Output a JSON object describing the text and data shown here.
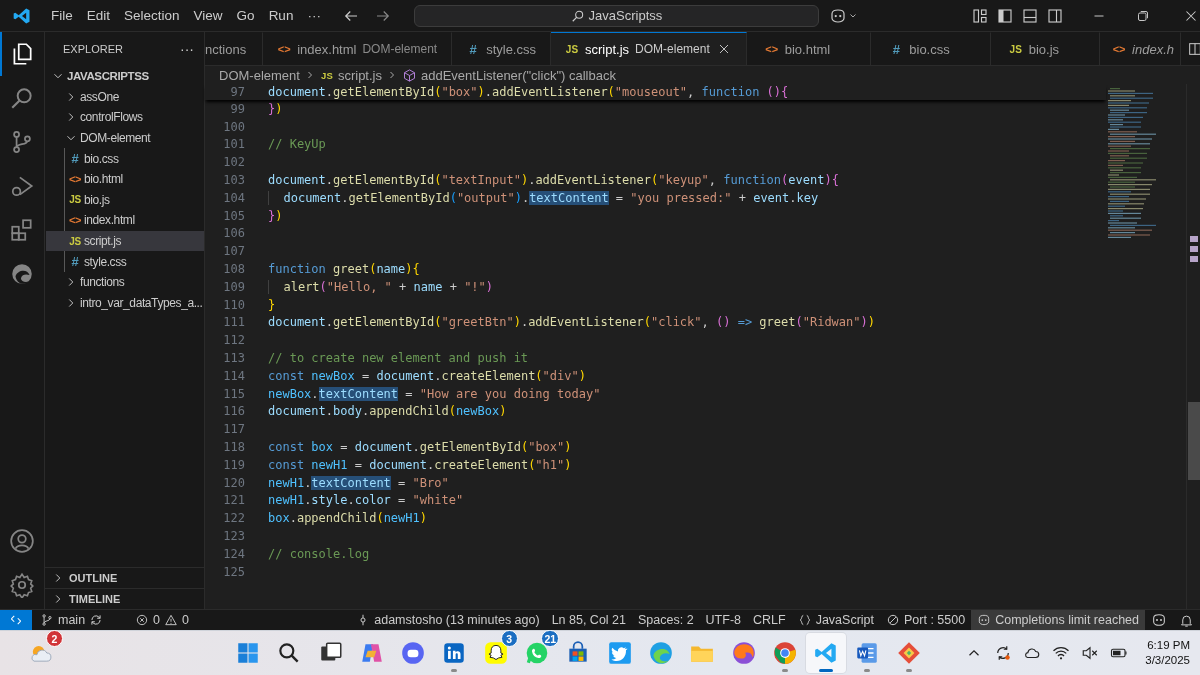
{
  "title_bar": {
    "menus": [
      "File",
      "Edit",
      "Selection",
      "View",
      "Go",
      "Run"
    ],
    "more": "···",
    "search": "JavaScriptss"
  },
  "activity_bar": [
    {
      "kind": "files",
      "selected": true
    },
    {
      "kind": "search",
      "selected": false
    },
    {
      "kind": "branch",
      "selected": false
    },
    {
      "kind": "debug",
      "selected": false
    },
    {
      "kind": "extensions",
      "selected": false
    },
    {
      "kind": "browser",
      "selected": false
    }
  ],
  "sidebar": {
    "title": "EXPLORER",
    "more": "···",
    "root": {
      "label": "JAVASCRIPTSS",
      "expanded": true,
      "children": [
        {
          "label": "assOne",
          "expanded": false,
          "selected": false
        },
        {
          "label": "controlFlows",
          "expanded": false,
          "selected": false
        },
        {
          "label": "DOM-element",
          "expanded": true,
          "selected": false,
          "children": [
            {
              "label": "bio.css",
              "kind": "css",
              "icon": "#",
              "selected": false
            },
            {
              "label": "bio.html",
              "kind": "html",
              "icon": "<>",
              "selected": false
            },
            {
              "label": "bio.js",
              "kind": "js",
              "icon": "JS",
              "selected": false
            },
            {
              "label": "index.html",
              "kind": "html",
              "icon": "<>",
              "selected": false
            },
            {
              "label": "script.js",
              "kind": "js",
              "icon": "JS",
              "selected": true
            },
            {
              "label": "style.css",
              "kind": "css",
              "icon": "#",
              "selected": false
            }
          ]
        },
        {
          "label": "functions",
          "expanded": false,
          "selected": false
        },
        {
          "label": "intro_var_dataTypes_a...",
          "expanded": false,
          "selected": false
        }
      ]
    },
    "sections": [
      {
        "label": "OUTLINE",
        "expanded": false
      },
      {
        "label": "TIMELINE",
        "expanded": false
      }
    ]
  },
  "tabs": [
    {
      "label": "nctions",
      "selected": false,
      "preview": false
    },
    {
      "label": "index.html",
      "detail": "DOM-element",
      "kind": "html",
      "icon": "<>",
      "selected": false,
      "preview": false
    },
    {
      "label": "style.css",
      "kind": "css",
      "icon": "#",
      "selected": false,
      "preview": false
    },
    {
      "label": "script.js",
      "detail": "DOM-element",
      "kind": "js",
      "icon": "JS",
      "selected": true,
      "preview": false
    },
    {
      "label": "bio.html",
      "kind": "html",
      "icon": "<>",
      "selected": false,
      "preview": false
    },
    {
      "label": "bio.css",
      "kind": "css",
      "icon": "#",
      "selected": false,
      "preview": false
    },
    {
      "label": "bio.js",
      "kind": "js",
      "icon": "JS",
      "selected": false,
      "preview": false
    },
    {
      "label": "index.h",
      "kind": "html",
      "icon": "<>",
      "selected": false,
      "preview": true
    }
  ],
  "breadcrumb": [
    {
      "kind": "folder",
      "text": "DOM-element"
    },
    {
      "kind": "js",
      "icon": "JS",
      "text": "script.js"
    },
    {
      "kind": "method",
      "text": "addEventListener(\"click\") callback"
    }
  ],
  "editor": {
    "sticky": {
      "number": "97",
      "tokens": [
        {
          "kind": "variable",
          "text": "document"
        },
        {
          "kind": "punct",
          "text": "."
        },
        {
          "kind": "function",
          "text": "getElementById"
        },
        {
          "kind": "bracket1",
          "text": "("
        },
        {
          "kind": "string",
          "text": "\"box\""
        },
        {
          "kind": "bracket1",
          "text": ")"
        },
        {
          "kind": "punct",
          "text": "."
        },
        {
          "kind": "function",
          "text": "addEventListener"
        },
        {
          "kind": "bracket1",
          "text": "("
        },
        {
          "kind": "string",
          "text": "\"mouseout\""
        },
        {
          "kind": "punct",
          "text": ","
        },
        {
          "kind": "keyword",
          "text": " function "
        },
        {
          "kind": "bracket2",
          "text": "(){"
        }
      ]
    },
    "lines": [
      {
        "number": "99",
        "tokens": [
          {
            "kind": "bracket2",
            "text": "}"
          },
          {
            "kind": "bracket1",
            "text": ")"
          }
        ]
      },
      {
        "number": "100"
      },
      {
        "number": "101",
        "tokens": [
          {
            "kind": "comment",
            "text": "// KeyUp"
          }
        ]
      },
      {
        "number": "102"
      },
      {
        "number": "103",
        "tokens": [
          {
            "kind": "variable",
            "text": "document"
          },
          {
            "kind": "punct",
            "text": "."
          },
          {
            "kind": "function",
            "text": "getElementById"
          },
          {
            "kind": "bracket1",
            "text": "("
          },
          {
            "kind": "string",
            "text": "\"textInput\""
          },
          {
            "kind": "bracket1",
            "text": ")"
          },
          {
            "kind": "punct",
            "text": "."
          },
          {
            "kind": "function",
            "text": "addEventListener"
          },
          {
            "kind": "bracket1",
            "text": "("
          },
          {
            "kind": "string",
            "text": "\"keyup\""
          },
          {
            "kind": "punct",
            "text": ","
          },
          {
            "kind": "keyword",
            "text": " function"
          },
          {
            "kind": "bracket2",
            "text": "("
          },
          {
            "kind": "variable",
            "text": "event"
          },
          {
            "kind": "bracket2",
            "text": "){"
          }
        ]
      },
      {
        "number": "104",
        "indent": true,
        "tokens": [
          {
            "kind": "variable",
            "text": "document"
          },
          {
            "kind": "punct",
            "text": "."
          },
          {
            "kind": "function",
            "text": "getElementById"
          },
          {
            "kind": "bracket3",
            "text": "("
          },
          {
            "kind": "string",
            "text": "\"output\""
          },
          {
            "kind": "bracket3",
            "text": ")"
          },
          {
            "kind": "punct",
            "text": "."
          },
          {
            "kind": "match",
            "text": "textContent"
          },
          {
            "kind": "punct",
            "text": " = "
          },
          {
            "kind": "string",
            "text": "\"you pressed:\""
          },
          {
            "kind": "punct",
            "text": " + "
          },
          {
            "kind": "variable",
            "text": "event"
          },
          {
            "kind": "punct",
            "text": "."
          },
          {
            "kind": "variable",
            "text": "key"
          }
        ]
      },
      {
        "number": "105",
        "tokens": [
          {
            "kind": "bracket2",
            "text": "}"
          },
          {
            "kind": "bracket1",
            "text": ")"
          }
        ]
      },
      {
        "number": "106"
      },
      {
        "number": "107"
      },
      {
        "number": "108",
        "tokens": [
          {
            "kind": "keyword",
            "text": "function "
          },
          {
            "kind": "function",
            "text": "greet"
          },
          {
            "kind": "bracket1",
            "text": "("
          },
          {
            "kind": "variable",
            "text": "name"
          },
          {
            "kind": "bracket1",
            "text": "){"
          }
        ]
      },
      {
        "number": "109",
        "indent": true,
        "tokens": [
          {
            "kind": "function",
            "text": "alert"
          },
          {
            "kind": "bracket2",
            "text": "("
          },
          {
            "kind": "string",
            "text": "\"Hello, \""
          },
          {
            "kind": "punct",
            "text": " + "
          },
          {
            "kind": "variable",
            "text": "name"
          },
          {
            "kind": "punct",
            "text": " + "
          },
          {
            "kind": "string",
            "text": "\"!\""
          },
          {
            "kind": "bracket2",
            "text": ")"
          }
        ]
      },
      {
        "number": "110",
        "tokens": [
          {
            "kind": "bracket1",
            "text": "}"
          }
        ]
      },
      {
        "number": "111",
        "tokens": [
          {
            "kind": "variable",
            "text": "document"
          },
          {
            "kind": "punct",
            "text": "."
          },
          {
            "kind": "function",
            "text": "getElementById"
          },
          {
            "kind": "bracket1",
            "text": "("
          },
          {
            "kind": "string",
            "text": "\"greetBtn\""
          },
          {
            "kind": "bracket1",
            "text": ")"
          },
          {
            "kind": "punct",
            "text": "."
          },
          {
            "kind": "function",
            "text": "addEventListener"
          },
          {
            "kind": "bracket1",
            "text": "("
          },
          {
            "kind": "string",
            "text": "\"click\""
          },
          {
            "kind": "punct",
            "text": ", "
          },
          {
            "kind": "bracket2",
            "text": "()"
          },
          {
            "kind": "keyword",
            "text": " => "
          },
          {
            "kind": "function",
            "text": "greet"
          },
          {
            "kind": "bracket2",
            "text": "("
          },
          {
            "kind": "string",
            "text": "\"Ridwan\""
          },
          {
            "kind": "bracket2",
            "text": ")"
          },
          {
            "kind": "bracket1",
            "text": ")"
          }
        ]
      },
      {
        "number": "112"
      },
      {
        "number": "113",
        "tokens": [
          {
            "kind": "comment",
            "text": "// to create new element and push it"
          }
        ]
      },
      {
        "number": "114",
        "tokens": [
          {
            "kind": "keyword",
            "text": "const "
          },
          {
            "kind": "constant",
            "text": "newBox"
          },
          {
            "kind": "punct",
            "text": " = "
          },
          {
            "kind": "variable",
            "text": "document"
          },
          {
            "kind": "punct",
            "text": "."
          },
          {
            "kind": "function",
            "text": "createElement"
          },
          {
            "kind": "bracket1",
            "text": "("
          },
          {
            "kind": "string",
            "text": "\"div\""
          },
          {
            "kind": "bracket1",
            "text": ")"
          }
        ]
      },
      {
        "number": "115",
        "tokens": [
          {
            "kind": "constant",
            "text": "newBox"
          },
          {
            "kind": "punct",
            "text": "."
          },
          {
            "kind": "match",
            "text": "textContent"
          },
          {
            "kind": "punct",
            "text": " = "
          },
          {
            "kind": "string",
            "text": "\"How are you doing today\""
          }
        ]
      },
      {
        "number": "116",
        "tokens": [
          {
            "kind": "variable",
            "text": "document"
          },
          {
            "kind": "punct",
            "text": "."
          },
          {
            "kind": "variable",
            "text": "body"
          },
          {
            "kind": "punct",
            "text": "."
          },
          {
            "kind": "function",
            "text": "appendChild"
          },
          {
            "kind": "bracket1",
            "text": "("
          },
          {
            "kind": "constant",
            "text": "newBox"
          },
          {
            "kind": "bracket1",
            "text": ")"
          }
        ]
      },
      {
        "number": "117"
      },
      {
        "number": "118",
        "tokens": [
          {
            "kind": "keyword",
            "text": "const "
          },
          {
            "kind": "constant",
            "text": "box"
          },
          {
            "kind": "punct",
            "text": " = "
          },
          {
            "kind": "variable",
            "text": "document"
          },
          {
            "kind": "punct",
            "text": "."
          },
          {
            "kind": "function",
            "text": "getElementById"
          },
          {
            "kind": "bracket1",
            "text": "("
          },
          {
            "kind": "string",
            "text": "\"box\""
          },
          {
            "kind": "bracket1",
            "text": ")"
          }
        ]
      },
      {
        "number": "119",
        "tokens": [
          {
            "kind": "keyword",
            "text": "const "
          },
          {
            "kind": "constant",
            "text": "newH1"
          },
          {
            "kind": "punct",
            "text": " = "
          },
          {
            "kind": "variable",
            "text": "document"
          },
          {
            "kind": "punct",
            "text": "."
          },
          {
            "kind": "function",
            "text": "createElement"
          },
          {
            "kind": "bracket1",
            "text": "("
          },
          {
            "kind": "string",
            "text": "\"h1\""
          },
          {
            "kind": "bracket1",
            "text": ")"
          }
        ]
      },
      {
        "number": "120",
        "tokens": [
          {
            "kind": "constant",
            "text": "newH1"
          },
          {
            "kind": "punct",
            "text": "."
          },
          {
            "kind": "match",
            "text": "textContent"
          },
          {
            "kind": "punct",
            "text": " = "
          },
          {
            "kind": "string",
            "text": "\"Bro\""
          }
        ]
      },
      {
        "number": "121",
        "tokens": [
          {
            "kind": "constant",
            "text": "newH1"
          },
          {
            "kind": "punct",
            "text": "."
          },
          {
            "kind": "variable",
            "text": "style"
          },
          {
            "kind": "punct",
            "text": "."
          },
          {
            "kind": "variable",
            "text": "color"
          },
          {
            "kind": "punct",
            "text": " = "
          },
          {
            "kind": "string",
            "text": "\"white\""
          }
        ]
      },
      {
        "number": "122",
        "tokens": [
          {
            "kind": "constant",
            "text": "box"
          },
          {
            "kind": "punct",
            "text": "."
          },
          {
            "kind": "function",
            "text": "appendChild"
          },
          {
            "kind": "bracket1",
            "text": "("
          },
          {
            "kind": "constant",
            "text": "newH1"
          },
          {
            "kind": "bracket1",
            "text": ")"
          }
        ]
      },
      {
        "number": "123"
      },
      {
        "number": "124",
        "tokens": [
          {
            "kind": "comment",
            "text": "// console.log"
          }
        ]
      },
      {
        "number": "125"
      }
    ]
  },
  "status_bar": {
    "branch": "main",
    "errors": "0",
    "warnings": "0",
    "items": [
      {
        "kind": "git",
        "text": "adamstosho (13 minutes ago)"
      },
      {
        "kind": "plain",
        "text": "Ln 85, Col 21"
      },
      {
        "kind": "plain",
        "text": "Spaces: 2"
      },
      {
        "kind": "plain",
        "text": "UTF-8"
      },
      {
        "kind": "plain",
        "text": "CRLF"
      },
      {
        "kind": "language",
        "text": "JavaScript"
      },
      {
        "kind": "port",
        "text": "Port : 5500"
      },
      {
        "kind": "warning",
        "text": "Completions limit reached"
      }
    ]
  },
  "taskbar": {
    "weather_badge": "2",
    "apps": [
      {
        "kind": "start",
        "selected": false,
        "running": false
      },
      {
        "kind": "search",
        "selected": false,
        "running": false
      },
      {
        "kind": "taskview",
        "selected": false,
        "running": false
      },
      {
        "kind": "copilot",
        "selected": false,
        "running": false
      },
      {
        "kind": "chat",
        "selected": false,
        "running": false
      },
      {
        "kind": "linkedin",
        "selected": false,
        "running": true
      },
      {
        "kind": "ghost",
        "badge": "3",
        "selected": false,
        "running": false
      },
      {
        "kind": "phone",
        "badge": "21",
        "selected": false,
        "running": false
      },
      {
        "kind": "store",
        "selected": false,
        "running": false
      },
      {
        "kind": "bird",
        "selected": false,
        "running": false
      },
      {
        "kind": "browser",
        "selected": false,
        "running": false
      },
      {
        "kind": "folder",
        "selected": false,
        "running": false
      },
      {
        "kind": "fox",
        "selected": false,
        "running": false
      },
      {
        "kind": "chrome",
        "selected": false,
        "running": true
      },
      {
        "kind": "code",
        "selected": true,
        "running": true
      },
      {
        "kind": "word",
        "selected": false,
        "running": true
      },
      {
        "kind": "diamond",
        "selected": false,
        "running": true
      }
    ],
    "time": "6:19 PM",
    "date": "3/3/2025"
  }
}
